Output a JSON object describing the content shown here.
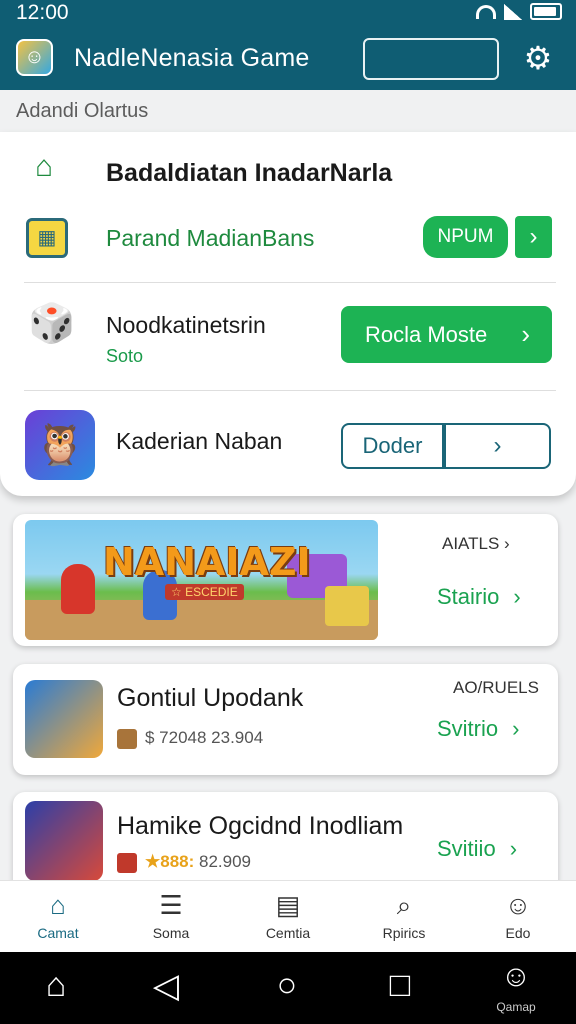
{
  "status": {
    "time": "12:00"
  },
  "header": {
    "title": "NadleNenasia  Game"
  },
  "section_label": "Adandi  Olartus",
  "main_card": {
    "title": "Badaldiatan InadarNarla",
    "row1": {
      "text": "Parand MadianBans",
      "pill": "NPUM",
      "chevron": "›"
    },
    "row2": {
      "title": "Noodkatinetsrin",
      "sub": "Soto",
      "button": "Rocla Moste",
      "chevron": "›"
    },
    "row3": {
      "title": "Kaderian Naban",
      "button": "Doder",
      "chevron": "›"
    }
  },
  "games": [
    {
      "banner_title": "NANAIAZI",
      "banner_sub": "☆ ESCEDIE",
      "tag": "AIATLS ›",
      "price": "Stairio",
      "chevron": "›"
    },
    {
      "title": "Gontiul Upodank",
      "tag": "AO/RUELS",
      "meta": "$ 72048 23.904",
      "price": "Svitrio",
      "chevron": "›"
    },
    {
      "title": "Hamike Ogcidnd Inodliam",
      "meta_stars": "★888:",
      "meta": "82.909",
      "price": "Svitiio",
      "chevron": "›"
    }
  ],
  "bottom_nav": [
    {
      "label": "Camat",
      "icon": "home-icon",
      "active": true
    },
    {
      "label": "Soma",
      "icon": "list-icon",
      "active": false
    },
    {
      "label": "Cemtia",
      "icon": "clipboard-icon",
      "active": false
    },
    {
      "label": "Rpirics",
      "icon": "search-icon",
      "active": false
    },
    {
      "label": "Edo",
      "icon": "profile-icon",
      "active": false
    }
  ],
  "system_nav": {
    "profile_label": "Qamap"
  },
  "colors": {
    "primary": "#0f5d73",
    "green": "#1db354",
    "outline": "#1a6577"
  }
}
